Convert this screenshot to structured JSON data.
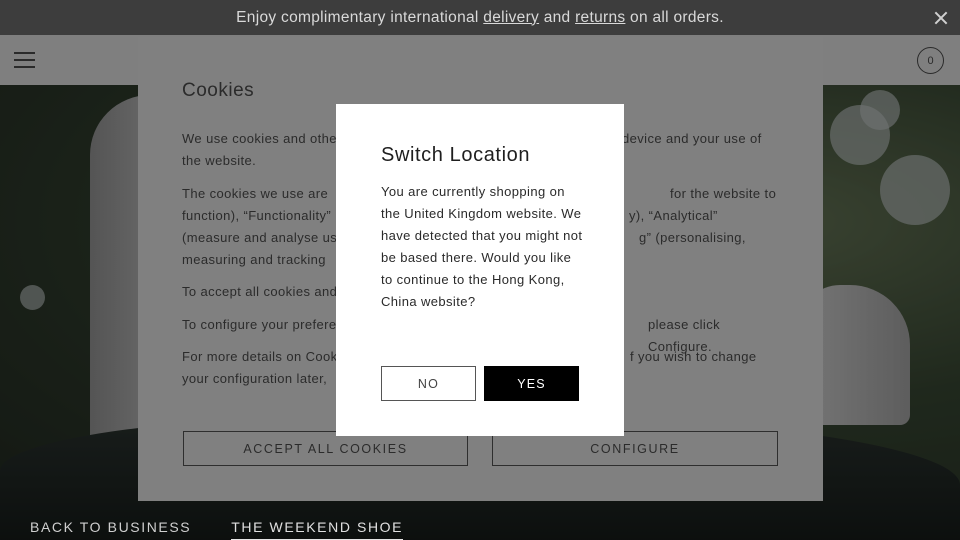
{
  "promo": {
    "text_before": "Enjoy complimentary international ",
    "delivery_link": "delivery",
    "text_middle": " and ",
    "returns_link": "returns",
    "text_after": " on all orders."
  },
  "header": {
    "bag_count": "0"
  },
  "cookies": {
    "title": "Cookies",
    "p1": "We use cookies and othe",
    "p1_end": "device and your use of",
    "p1_line2": "the website.",
    "p2_l1": "The cookies we use are",
    "p2_l1_end": "for the website to",
    "p2_l2": "function), “Functionality”",
    "p2_l2_end": "y), “Analytical”",
    "p2_l3": "(measure and analyse us",
    "p2_l3_end": "g” (personalising,",
    "p2_l4": "measuring and tracking",
    "p3": "To accept all cookies and",
    "p4": "To configure your prefere",
    "p4_end": "please click Configure.",
    "p5_l1": "For more details on Cook",
    "p5_l1_end": "f you wish to change",
    "p5_l2": "your configuration later,",
    "accept_label": "ACCEPT ALL COOKIES",
    "configure_label": "CONFIGURE"
  },
  "modal": {
    "title": "Switch Location",
    "body": "You are currently shopping on the United Kingdom website. We have detected that you might not be based there. Would you like to continue to the Hong Kong, China website?",
    "no_label": "NO",
    "yes_label": "YES"
  },
  "hero": {
    "tabs": [
      "BACK TO BUSINESS",
      "THE WEEKEND SHOE"
    ],
    "active_tab": "THE WEEKEND SHOE"
  }
}
